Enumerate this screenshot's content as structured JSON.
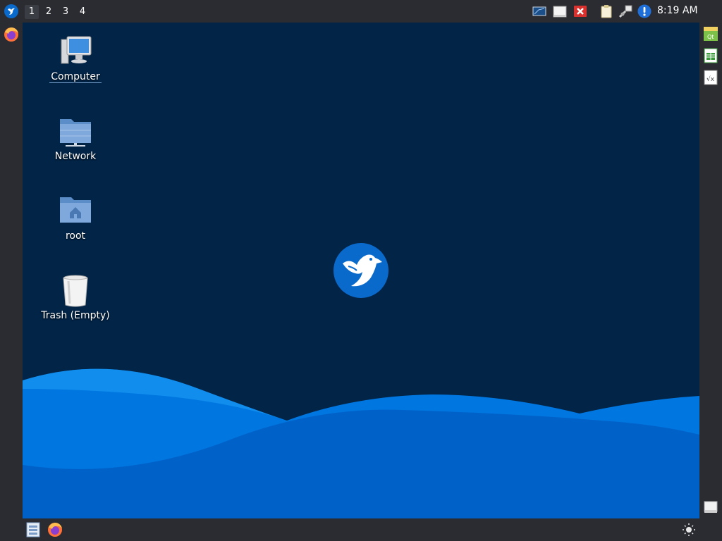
{
  "panel": {
    "workspaces": [
      {
        "label": "1",
        "active": true
      },
      {
        "label": "2",
        "active": false
      },
      {
        "label": "3",
        "active": false
      },
      {
        "label": "4",
        "active": false
      }
    ],
    "tray_icons": [
      "display-icon",
      "notes-icon",
      "close-red-icon",
      "clipboard-icon",
      "network-icon",
      "info-icon"
    ],
    "clock": "8:19 AM"
  },
  "desktop": {
    "icons": [
      {
        "label": "Computer",
        "icon": "computer-icon",
        "selected": true
      },
      {
        "label": "Network",
        "icon": "network-folder-icon",
        "selected": false
      },
      {
        "label": "root",
        "icon": "home-folder-icon",
        "selected": false
      },
      {
        "label": "Trash (Empty)",
        "icon": "trash-icon",
        "selected": false
      }
    ]
  },
  "left_dock": [
    "firefox-icon"
  ],
  "right_dock": [
    "qt-app-icon",
    "spreadsheet-icon",
    "formula-icon",
    "drive-icon"
  ],
  "bottom_bar": [
    "file-manager-icon",
    "firefox-icon",
    "brightness-icon"
  ],
  "colors": {
    "panel": "#2b2c31",
    "desktop_bg": "#022447",
    "wave_light": "#0a8ef0",
    "wave_dark": "#0066cc",
    "logo": "#0a6acb"
  }
}
